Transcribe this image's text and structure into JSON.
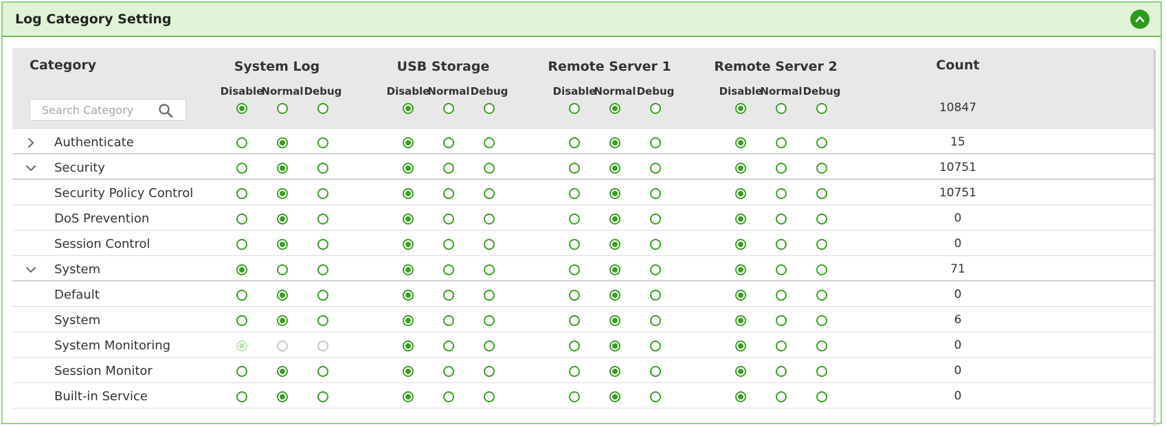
{
  "panel": {
    "title": "Log Category Setting"
  },
  "headers": {
    "category": "Category",
    "groups": [
      "System Log",
      "USB Storage",
      "Remote Server 1",
      "Remote Server 2"
    ],
    "sub": [
      "Disable",
      "Normal",
      "Debug"
    ],
    "count": "Count"
  },
  "search": {
    "placeholder": "Search Category",
    "value": ""
  },
  "master": {
    "selections": [
      0,
      0,
      1,
      0
    ],
    "count": "10847"
  },
  "rows": [
    {
      "label": "Authenticate",
      "type": "group",
      "expander": "collapsed",
      "selections": [
        1,
        0,
        1,
        0
      ],
      "count": "15"
    },
    {
      "label": "Security",
      "type": "group",
      "expander": "expanded",
      "selections": [
        1,
        0,
        1,
        0
      ],
      "count": "10751"
    },
    {
      "label": "Security Policy Control",
      "type": "child",
      "selections": [
        1,
        0,
        1,
        0
      ],
      "count": "10751"
    },
    {
      "label": "DoS Prevention",
      "type": "child",
      "selections": [
        1,
        0,
        1,
        0
      ],
      "count": "0"
    },
    {
      "label": "Session Control",
      "type": "child",
      "selections": [
        1,
        0,
        1,
        0
      ],
      "count": "0"
    },
    {
      "label": "System",
      "type": "group",
      "expander": "expanded",
      "selections": [
        0,
        0,
        1,
        0
      ],
      "count": "71"
    },
    {
      "label": "Default",
      "type": "child",
      "selections": [
        1,
        0,
        1,
        0
      ],
      "count": "0"
    },
    {
      "label": "System",
      "type": "child",
      "selections": [
        1,
        0,
        1,
        0
      ],
      "count": "6"
    },
    {
      "label": "System Monitoring",
      "type": "child",
      "selections": [
        0,
        0,
        1,
        0
      ],
      "disabled_groups": [
        0
      ],
      "count": "0"
    },
    {
      "label": "Session Monitor",
      "type": "child",
      "selections": [
        1,
        0,
        1,
        0
      ],
      "count": "0"
    },
    {
      "label": "Built-in Service",
      "type": "child",
      "selections": [
        1,
        0,
        1,
        0
      ],
      "count": "0"
    }
  ],
  "colors": {
    "accent": "#3d9e27",
    "header_bg": "#e1f3d6",
    "table_head_bg": "#e8e8e8"
  },
  "icons": {
    "collapse": "chevron-up-icon",
    "search": "search-icon",
    "expand": "chevron-right-icon",
    "collapse_row": "chevron-down-icon"
  }
}
